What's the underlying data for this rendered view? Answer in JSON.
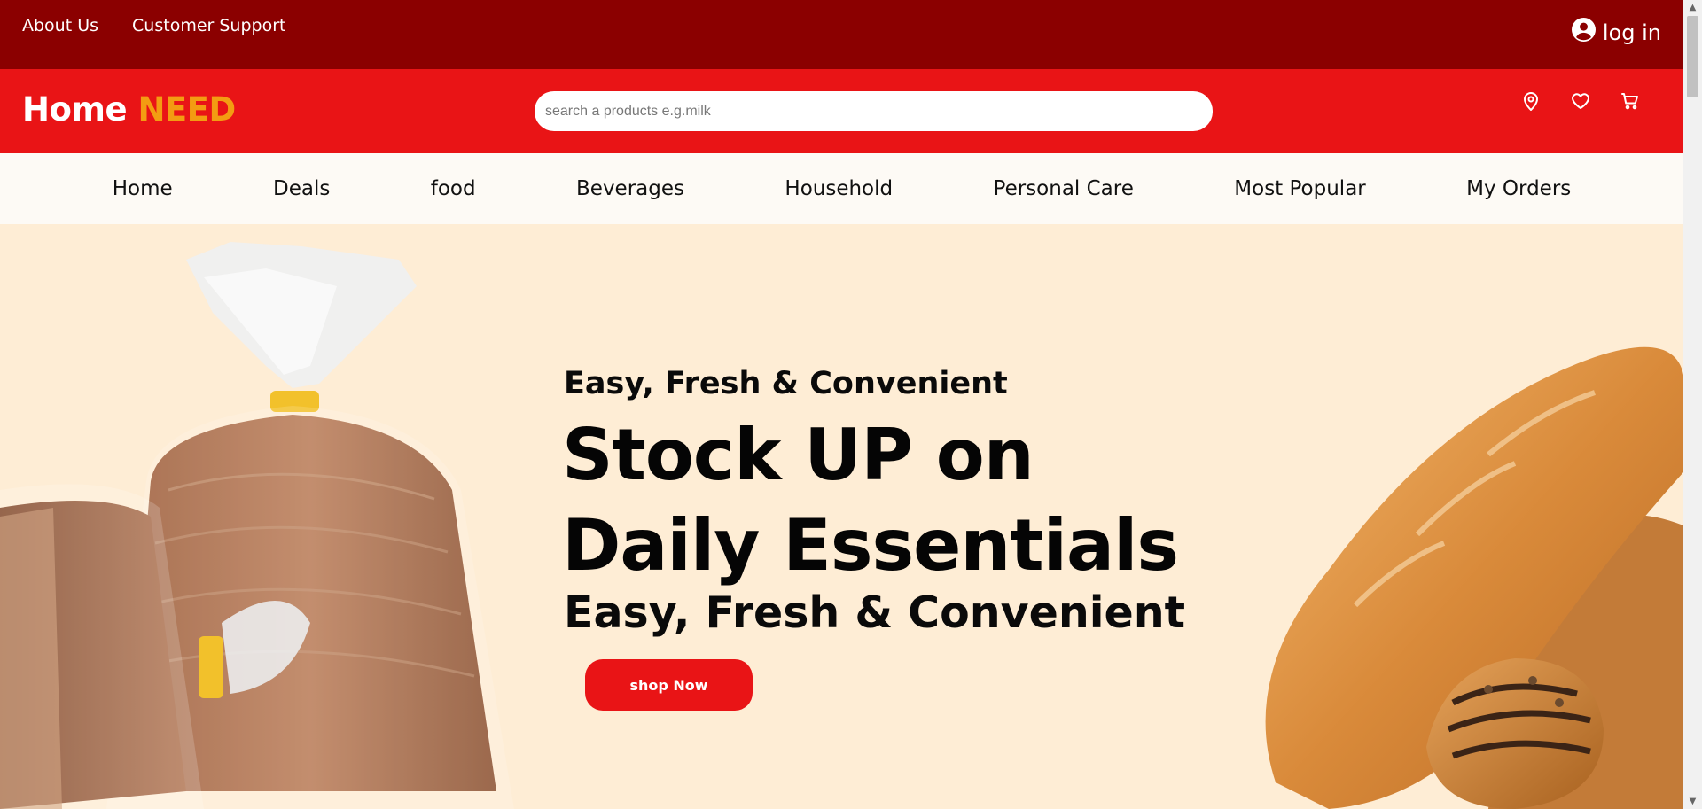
{
  "topbar": {
    "links": [
      "About Us",
      "Customer Support"
    ],
    "login_label": "log in"
  },
  "header": {
    "logo_part1": "Home",
    "logo_part2": "NEED",
    "search_placeholder": "search a products e.g.milk",
    "icons": [
      "location-pin-icon",
      "heart-icon",
      "cart-icon"
    ]
  },
  "nav": {
    "items": [
      "Home",
      "Deals",
      "food",
      "Beverages",
      "Household",
      "Personal Care",
      "Most Popular",
      "My Orders"
    ]
  },
  "hero": {
    "kicker": "Easy, Fresh & Convenient",
    "headline_line1": "Stock UP on",
    "headline_line2": "Daily Essentials",
    "subheadline": "Easy, Fresh & Convenient",
    "cta_label": "shop Now"
  },
  "colors": {
    "topbar_bg": "#8b0000",
    "header_bg": "#e91416",
    "logo_accent": "#f39c12",
    "hero_bg": "#feedd5",
    "cta_bg": "#e91416"
  }
}
